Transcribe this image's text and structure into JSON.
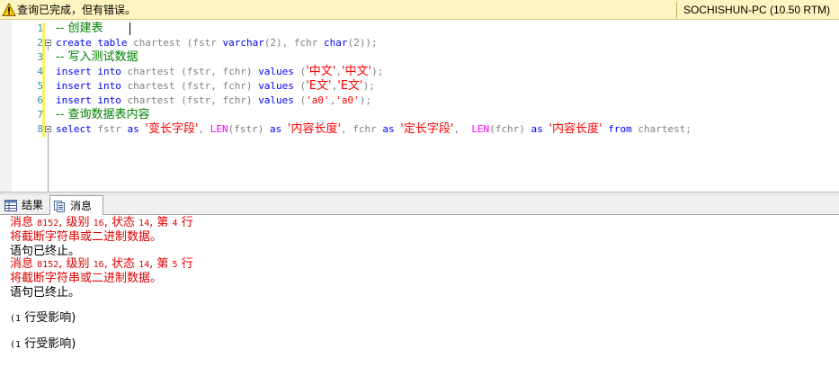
{
  "status_bar": {
    "message": "查询已完成，但有错误。",
    "server": "SOCHISHUN-PC (10.50 RTM)"
  },
  "editor": {
    "line_numbers": [
      "1",
      "2",
      "3",
      "4",
      "5",
      "6",
      "7",
      "8"
    ],
    "line1": {
      "comment": "-- 创建表"
    },
    "line2": {
      "kw1": "create table",
      "t1": " chartest (fstr ",
      "kw2": "varchar",
      "t2": "(2), fchr ",
      "kw3": "char",
      "t3": "(2));"
    },
    "line3": {
      "comment": "-- 写入测试数据"
    },
    "line4": {
      "kw1": "insert into",
      "t1": " chartest (fstr, fchr) ",
      "kw2": "values",
      "t2": " (",
      "s1": "'中文'",
      "t3": ",",
      "s2": "'中文'",
      "t4": ");"
    },
    "line5": {
      "kw1": "insert into",
      "t1": " chartest (fstr, fchr) ",
      "kw2": "values",
      "t2": " (",
      "s1": "'E文'",
      "t3": ",",
      "s2": "'E文'",
      "t4": ");"
    },
    "line6": {
      "kw1": "insert into",
      "t1": " chartest (fstr, fchr) ",
      "kw2": "values",
      "t2": " (",
      "s1": "'a0'",
      "t3": ",",
      "s2": "'a0'",
      "t4": ");"
    },
    "line7": {
      "comment": "-- 查询数据表内容"
    },
    "line8": {
      "kw1": "select",
      "t1": " fstr ",
      "kw2": "as",
      "t2": " ",
      "s1": "'变长字段'",
      "t3": ", ",
      "fn1": "LEN",
      "t4": "(fstr) ",
      "kw3": "as",
      "t5": " ",
      "s2": "'内容长度'",
      "t6": ", fchr ",
      "kw4": "as",
      "t7": " ",
      "s3": "'定长字段'",
      "t8": ",  ",
      "fn2": "LEN",
      "t9": "(fchr) ",
      "kw5": "as",
      "t10": " ",
      "s4": "'内容长度'",
      "t11": " ",
      "kw6": "from",
      "t12": " chartest;"
    }
  },
  "tabs": {
    "results": "结果",
    "messages": "消息"
  },
  "messages": {
    "error1": {
      "a": "消息 ",
      "n1": "8152",
      "b": ", 级别 ",
      "n2": "16",
      "c": ", 状态 ",
      "n3": "14",
      "d": ", 第 ",
      "n4": "4",
      "e": " 行"
    },
    "error1_text": "将截断字符串或二进制数据。",
    "terminated1": "语句已终止。",
    "error2": {
      "a": "消息 ",
      "n1": "8152",
      "b": ", 级别 ",
      "n2": "16",
      "c": ", 状态 ",
      "n3": "14",
      "d": ", 第 ",
      "n4": "5",
      "e": " 行"
    },
    "error2_text": "将截断字符串或二进制数据。",
    "terminated2": "语句已终止。",
    "affected1": {
      "open": "(",
      "num": "1",
      "text": " 行受影响)"
    },
    "affected2": {
      "open": "(",
      "num": "1",
      "text": " 行受影响)"
    }
  }
}
